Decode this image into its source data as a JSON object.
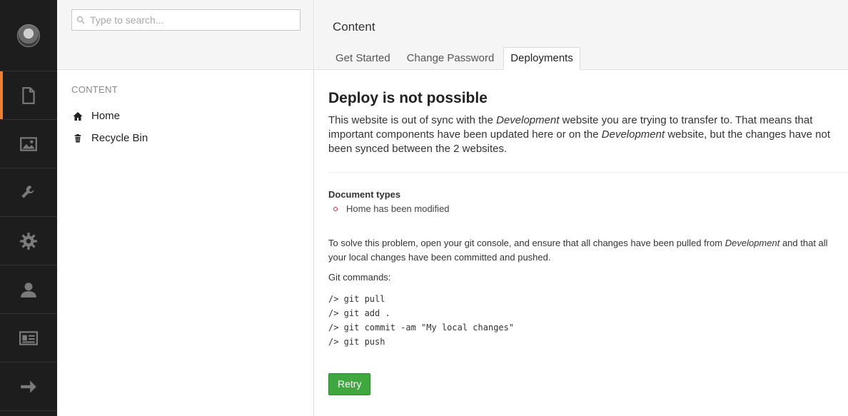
{
  "leftbar": {
    "items": [
      {
        "icon": "document-icon",
        "active": true
      },
      {
        "icon": "image-icon",
        "active": false
      },
      {
        "icon": "wrench-icon",
        "active": false
      },
      {
        "icon": "gear-icon",
        "active": false
      },
      {
        "icon": "user-icon",
        "active": false
      },
      {
        "icon": "id-card-icon",
        "active": false
      },
      {
        "icon": "arrow-right-icon",
        "active": false
      }
    ],
    "accent_color": "#f0802c"
  },
  "tree": {
    "search_placeholder": "Type to search...",
    "section_label": "CONTENT",
    "items": [
      {
        "label": "Home",
        "icon": "home-icon"
      },
      {
        "label": "Recycle Bin",
        "icon": "trash-icon"
      }
    ]
  },
  "main": {
    "title": "Content",
    "tabs": [
      {
        "label": "Get Started",
        "active": false
      },
      {
        "label": "Change Password",
        "active": false
      },
      {
        "label": "Deployments",
        "active": true
      }
    ],
    "headline": "Deploy is not possible",
    "intro_part1": "This website is out of sync with the ",
    "intro_em1": "Development",
    "intro_part2": " website you are trying to transfer to. That means that important components have been updated here or on the ",
    "intro_em2": "Development",
    "intro_part3": " website, but the changes have not been synced between the 2 websites.",
    "doctypes_label": "Document types",
    "doctypes": [
      "Home has been modified"
    ],
    "solve_part1": "To solve this problem, open your git console, and ensure that all changes have been pulled from ",
    "solve_em": "Development",
    "solve_part2": " and that all your local changes have been committed and pushed.",
    "git_label": "Git commands:",
    "git_commands": [
      "/> git pull",
      "/> git add .",
      "/> git commit -am \"My local changes\"",
      "/> git push"
    ],
    "retry_label": "Retry",
    "retry_color": "#3ea83f"
  }
}
